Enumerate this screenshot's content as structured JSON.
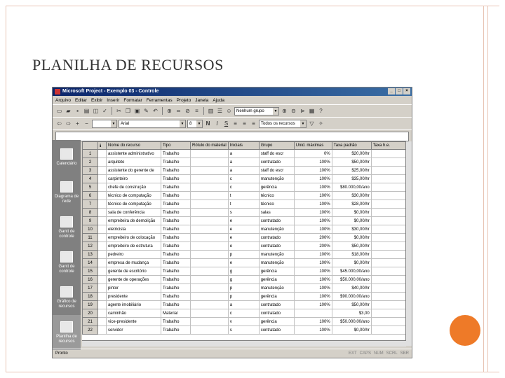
{
  "slide": {
    "title": "PLANILHA DE RECURSOS",
    "accent": "#ee7a28",
    "frame_color": "#e8c4b4"
  },
  "window": {
    "title": "Microsoft Project - Exemplo 03 - Controle",
    "buttons": [
      "_",
      "□",
      "×"
    ]
  },
  "menu": [
    "Arquivo",
    "Editar",
    "Exibir",
    "Inserir",
    "Formatar",
    "Ferramentas",
    "Projeto",
    "Janela",
    "Ajuda"
  ],
  "toolbar": {
    "group_value": "Nenhum grupo",
    "font_value": "Arial",
    "size_value": "8",
    "filter_value": "Todos os recursos"
  },
  "views": [
    {
      "label": "Calendário",
      "icon": "calendar-icon"
    },
    {
      "label": "Diagrama de rede",
      "icon": "network-diagram-icon"
    },
    {
      "label": "Gantt de controle",
      "icon": "tracking-gantt-icon"
    },
    {
      "label": "Gantt de controle",
      "icon": "gantt-icon"
    },
    {
      "label": "Gráfico de recursos",
      "icon": "resource-graph-icon"
    },
    {
      "label": "Planilha de recursos",
      "icon": "resource-sheet-icon"
    }
  ],
  "columns": [
    "Nome do recurso",
    "Tipo",
    "Rótulo do material",
    "Iniciais",
    "Grupo",
    "Unid. máximas",
    "Taxa padrão",
    "Taxa h.e."
  ],
  "rows": [
    [
      "1",
      "assistente administrativo",
      "Trabalho",
      "",
      "a",
      "staff do escr",
      "0%",
      "$20,00/hr"
    ],
    [
      "2",
      "arquiteto",
      "Trabalho",
      "",
      "a",
      "contratado",
      "100%",
      "$50,00/hr"
    ],
    [
      "3",
      "assistente do gerente de",
      "Trabalho",
      "",
      "a",
      "staff do escr",
      "100%",
      "$25,00/hr"
    ],
    [
      "4",
      "carpinteiro",
      "Trabalho",
      "",
      "c",
      "manutenção",
      "100%",
      "$35,00/hr"
    ],
    [
      "5",
      "chefe de construção",
      "Trabalho",
      "",
      "c",
      "gerência",
      "100%",
      "$80.000,00/ano"
    ],
    [
      "6",
      "técnico de computação",
      "Trabalho",
      "",
      "t",
      "técnico",
      "100%",
      "$30,00/hr"
    ],
    [
      "7",
      "técnico de computação",
      "Trabalho",
      "",
      "t",
      "técnico",
      "100%",
      "$28,00/hr"
    ],
    [
      "8",
      "sala de conferência",
      "Trabalho",
      "",
      "s",
      "salas",
      "100%",
      "$0,00/hr"
    ],
    [
      "9",
      "empreiteira de demolição",
      "Trabalho",
      "",
      "e",
      "contratado",
      "100%",
      "$0,00/hr"
    ],
    [
      "10",
      "eletricista",
      "Trabalho",
      "",
      "e",
      "manutenção",
      "100%",
      "$30,00/hr"
    ],
    [
      "11",
      "empreiteiro de colocação",
      "Trabalho",
      "",
      "e",
      "contratado",
      "200%",
      "$0,00/hr"
    ],
    [
      "12",
      "empreiteiro de estrutura",
      "Trabalho",
      "",
      "e",
      "contratado",
      "200%",
      "$50,00/hr"
    ],
    [
      "13",
      "pedreiro",
      "Trabalho",
      "",
      "p",
      "manutenção",
      "100%",
      "$18,00/hr"
    ],
    [
      "14",
      "empresa de mudança",
      "Trabalho",
      "",
      "e",
      "manutenção",
      "100%",
      "$0,00/hr"
    ],
    [
      "15",
      "gerente de escritório",
      "Trabalho",
      "",
      "g",
      "gerência",
      "100%",
      "$45.000,00/ano"
    ],
    [
      "16",
      "gerente de operações",
      "Trabalho",
      "",
      "g",
      "gerência",
      "100%",
      "$50.000,00/ano"
    ],
    [
      "17",
      "pintor",
      "Trabalho",
      "",
      "p",
      "manutenção",
      "100%",
      "$40,00/hr"
    ],
    [
      "18",
      "presidente",
      "Trabalho",
      "",
      "p",
      "gerência",
      "100%",
      "$90.000,00/ano"
    ],
    [
      "19",
      "agente imobiliário",
      "Trabalho",
      "",
      "a",
      "contratado",
      "100%",
      "$50,00/hr"
    ],
    [
      "20",
      "caminhão",
      "Material",
      "",
      "c",
      "contratado",
      "",
      "$3,00"
    ],
    [
      "21",
      "vice-presidente",
      "Trabalho",
      "",
      "v",
      "gerência",
      "100%",
      "$50.000,00/ano"
    ],
    [
      "22",
      "servidor",
      "Trabalho",
      "",
      "s",
      "contratado",
      "100%",
      "$0,00/hr"
    ]
  ],
  "status": {
    "left": "Pronto",
    "indicators": [
      "EXT",
      "CAPS",
      "NUM",
      "SCRL",
      "SBR"
    ]
  }
}
